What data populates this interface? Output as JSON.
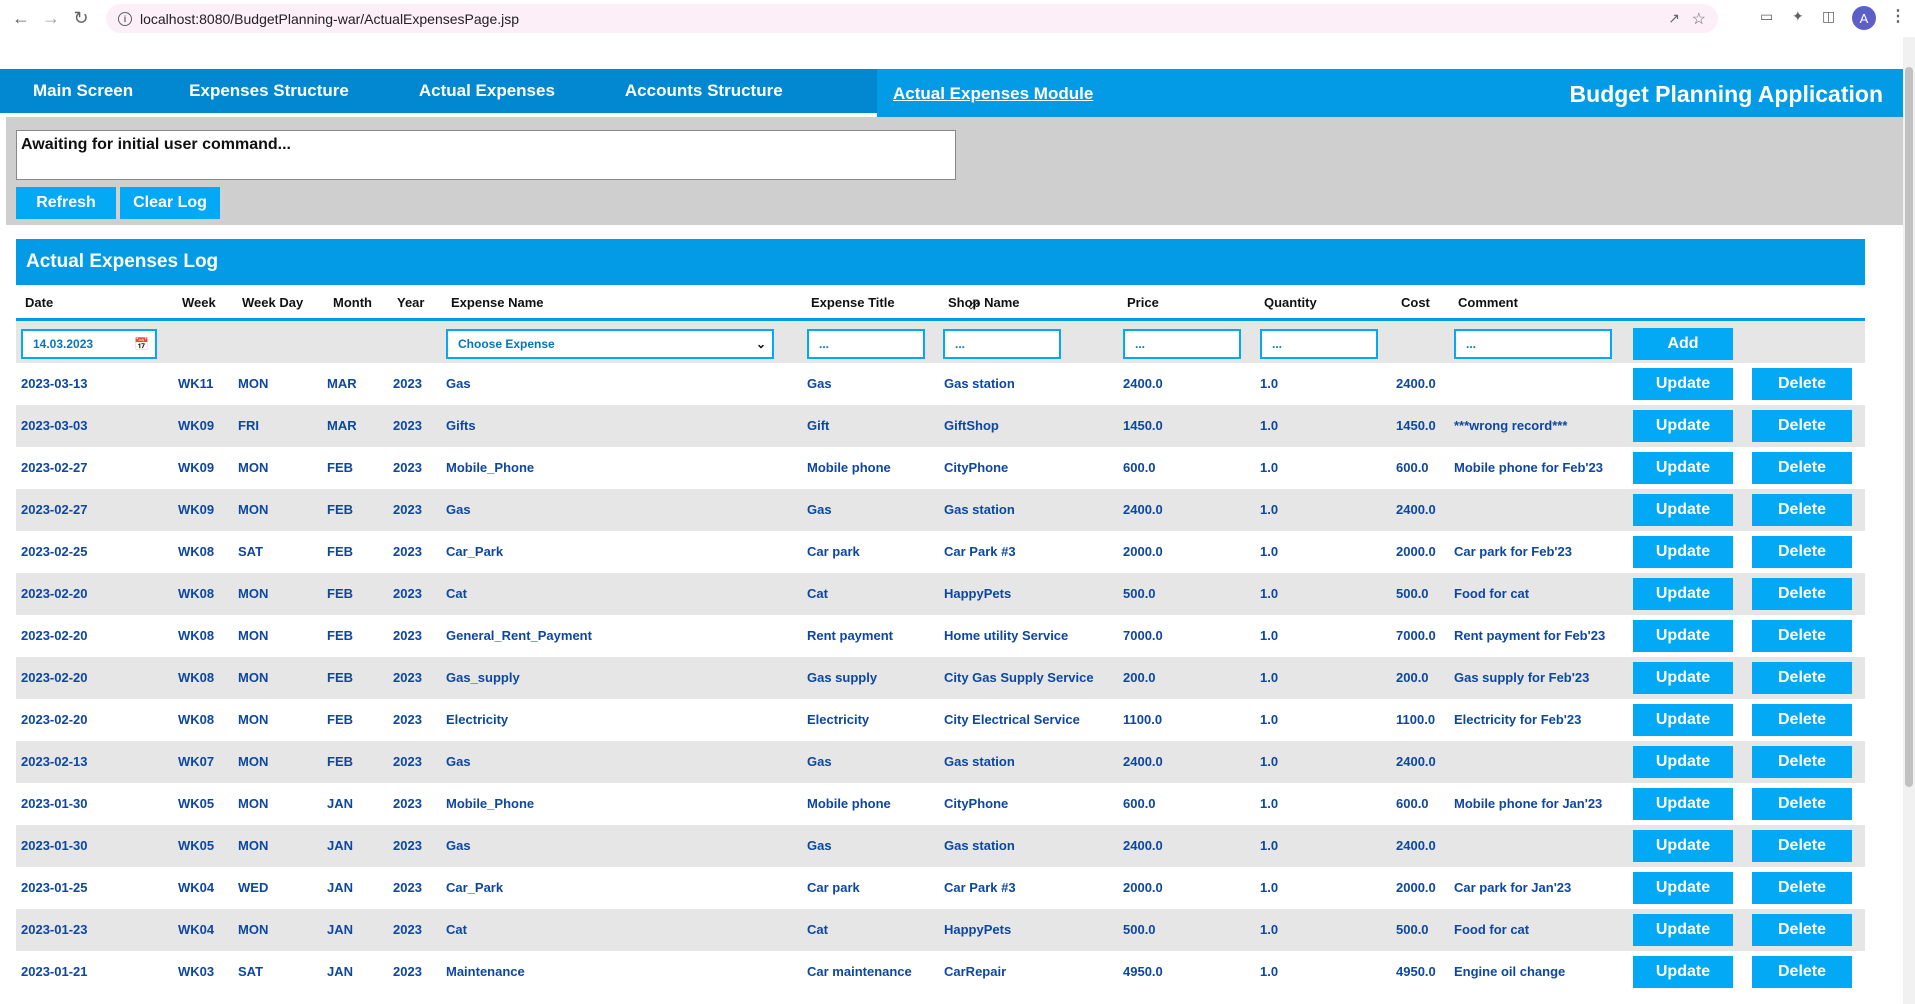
{
  "browser": {
    "url": "localhost:8080/BudgetPlanning-war/ActualExpensesPage.jsp",
    "avatar_letter": "A"
  },
  "nav": {
    "items": [
      "Main Screen",
      "Expenses Structure",
      "Actual Expenses",
      "Accounts Structure"
    ],
    "module_link": "Actual Expenses Module",
    "app_title": "Budget Planning Application"
  },
  "log": {
    "message": "Awaiting for initial user command...",
    "refresh_label": "Refresh",
    "clear_label": "Clear Log"
  },
  "section_title": "Actual Expenses Log",
  "columns": [
    "Date",
    "Week",
    "Week Day",
    "Month",
    "Year",
    "Expense Name",
    "Expense Title",
    "Shop Name",
    "Price",
    "Quantity",
    "Cost",
    "Comment"
  ],
  "input_row": {
    "date_value": "14.03.2023",
    "expense_select": "Choose Expense",
    "title_placeholder": "...",
    "shop_placeholder": "...",
    "price_placeholder": "...",
    "quantity_placeholder": "...",
    "comment_placeholder": "...",
    "add_label": "Add"
  },
  "row_buttons": {
    "update": "Update",
    "delete": "Delete"
  },
  "rows": [
    {
      "date": "2023-03-13",
      "week": "WK11",
      "day": "MON",
      "month": "MAR",
      "year": "2023",
      "name": "Gas",
      "title": "Gas",
      "shop": "Gas station",
      "price": "2400.0",
      "qty": "1.0",
      "cost": "2400.0",
      "comment": ""
    },
    {
      "date": "2023-03-03",
      "week": "WK09",
      "day": "FRI",
      "month": "MAR",
      "year": "2023",
      "name": "Gifts",
      "title": "Gift",
      "shop": "GiftShop",
      "price": "1450.0",
      "qty": "1.0",
      "cost": "1450.0",
      "comment": "***wrong record***"
    },
    {
      "date": "2023-02-27",
      "week": "WK09",
      "day": "MON",
      "month": "FEB",
      "year": "2023",
      "name": "Mobile_Phone",
      "title": "Mobile phone",
      "shop": "CityPhone",
      "price": "600.0",
      "qty": "1.0",
      "cost": "600.0",
      "comment": "Mobile phone for Feb'23"
    },
    {
      "date": "2023-02-27",
      "week": "WK09",
      "day": "MON",
      "month": "FEB",
      "year": "2023",
      "name": "Gas",
      "title": "Gas",
      "shop": "Gas station",
      "price": "2400.0",
      "qty": "1.0",
      "cost": "2400.0",
      "comment": ""
    },
    {
      "date": "2023-02-25",
      "week": "WK08",
      "day": "SAT",
      "month": "FEB",
      "year": "2023",
      "name": "Car_Park",
      "title": "Car park",
      "shop": "Car Park #3",
      "price": "2000.0",
      "qty": "1.0",
      "cost": "2000.0",
      "comment": "Car park for Feb'23"
    },
    {
      "date": "2023-02-20",
      "week": "WK08",
      "day": "MON",
      "month": "FEB",
      "year": "2023",
      "name": "Cat",
      "title": "Cat",
      "shop": "HappyPets",
      "price": "500.0",
      "qty": "1.0",
      "cost": "500.0",
      "comment": "Food for cat"
    },
    {
      "date": "2023-02-20",
      "week": "WK08",
      "day": "MON",
      "month": "FEB",
      "year": "2023",
      "name": "General_Rent_Payment",
      "title": "Rent payment",
      "shop": "Home utility Service",
      "price": "7000.0",
      "qty": "1.0",
      "cost": "7000.0",
      "comment": "Rent payment for Feb'23"
    },
    {
      "date": "2023-02-20",
      "week": "WK08",
      "day": "MON",
      "month": "FEB",
      "year": "2023",
      "name": "Gas_supply",
      "title": "Gas supply",
      "shop": "City Gas Supply Service",
      "price": "200.0",
      "qty": "1.0",
      "cost": "200.0",
      "comment": "Gas supply for Feb'23"
    },
    {
      "date": "2023-02-20",
      "week": "WK08",
      "day": "MON",
      "month": "FEB",
      "year": "2023",
      "name": "Electricity",
      "title": "Electricity",
      "shop": "City Electrical Service",
      "price": "1100.0",
      "qty": "1.0",
      "cost": "1100.0",
      "comment": "Electricity for Feb'23"
    },
    {
      "date": "2023-02-13",
      "week": "WK07",
      "day": "MON",
      "month": "FEB",
      "year": "2023",
      "name": "Gas",
      "title": "Gas",
      "shop": "Gas station",
      "price": "2400.0",
      "qty": "1.0",
      "cost": "2400.0",
      "comment": ""
    },
    {
      "date": "2023-01-30",
      "week": "WK05",
      "day": "MON",
      "month": "JAN",
      "year": "2023",
      "name": "Mobile_Phone",
      "title": "Mobile phone",
      "shop": "CityPhone",
      "price": "600.0",
      "qty": "1.0",
      "cost": "600.0",
      "comment": "Mobile phone for Jan'23"
    },
    {
      "date": "2023-01-30",
      "week": "WK05",
      "day": "MON",
      "month": "JAN",
      "year": "2023",
      "name": "Gas",
      "title": "Gas",
      "shop": "Gas station",
      "price": "2400.0",
      "qty": "1.0",
      "cost": "2400.0",
      "comment": ""
    },
    {
      "date": "2023-01-25",
      "week": "WK04",
      "day": "WED",
      "month": "JAN",
      "year": "2023",
      "name": "Car_Park",
      "title": "Car park",
      "shop": "Car Park #3",
      "price": "2000.0",
      "qty": "1.0",
      "cost": "2000.0",
      "comment": "Car park for Jan'23"
    },
    {
      "date": "2023-01-23",
      "week": "WK04",
      "day": "MON",
      "month": "JAN",
      "year": "2023",
      "name": "Cat",
      "title": "Cat",
      "shop": "HappyPets",
      "price": "500.0",
      "qty": "1.0",
      "cost": "500.0",
      "comment": "Food for cat"
    },
    {
      "date": "2023-01-21",
      "week": "WK03",
      "day": "SAT",
      "month": "JAN",
      "year": "2023",
      "name": "Maintenance",
      "title": "Car maintenance",
      "shop": "CarRepair",
      "price": "4950.0",
      "qty": "1.0",
      "cost": "4950.0",
      "comment": "Engine oil change"
    }
  ]
}
